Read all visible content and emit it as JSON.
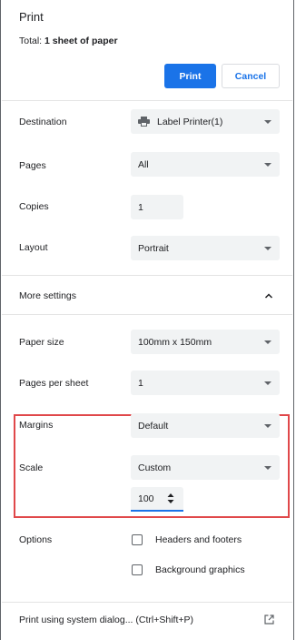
{
  "header": {
    "title": "Print",
    "total_prefix": "Total: ",
    "total_value": "1 sheet of paper"
  },
  "actions": {
    "print_label": "Print",
    "cancel_label": "Cancel"
  },
  "settings": {
    "destination": {
      "label": "Destination",
      "value": "Label Printer(1)",
      "icon": "printer-icon"
    },
    "pages": {
      "label": "Pages",
      "value": "All"
    },
    "copies": {
      "label": "Copies",
      "value": "1"
    },
    "layout": {
      "label": "Layout",
      "value": "Portrait"
    }
  },
  "more_settings": {
    "label": "More settings",
    "expanded": true,
    "paper_size": {
      "label": "Paper size",
      "value": "100mm x 150mm"
    },
    "pages_per_sheet": {
      "label": "Pages per sheet",
      "value": "1"
    },
    "margins": {
      "label": "Margins",
      "value": "Default"
    },
    "scale": {
      "label": "Scale",
      "value": "Custom",
      "custom_value": "100"
    },
    "options": {
      "label": "Options",
      "headers_and_footers": {
        "label": "Headers and footers",
        "checked": false
      },
      "background_graphics": {
        "label": "Background graphics",
        "checked": false
      }
    }
  },
  "footer": {
    "system_dialog_label": "Print using system dialog... (Ctrl+Shift+P)",
    "icon": "open-in-new-icon"
  },
  "colors": {
    "accent": "#1a73e8",
    "highlight": "#e0484a",
    "field_background": "#f1f3f4"
  }
}
